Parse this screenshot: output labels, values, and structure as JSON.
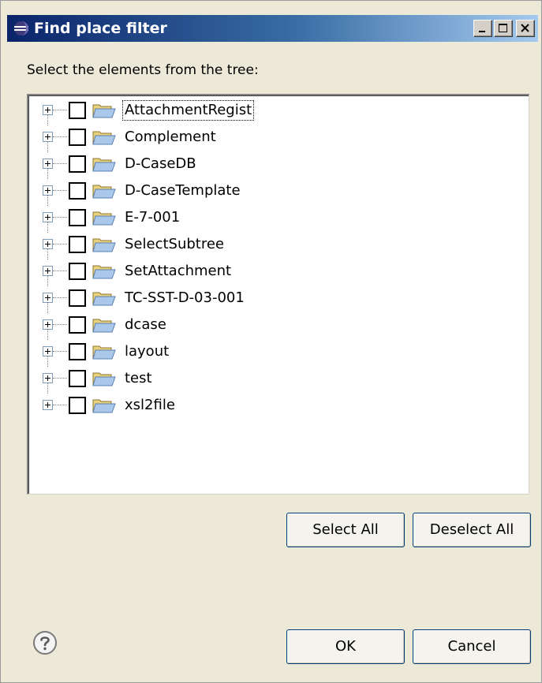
{
  "window": {
    "title": "Find place filter",
    "accent": "#0a246a"
  },
  "instruction": "Select the elements from the tree:",
  "tree": {
    "items": [
      {
        "label": "AttachmentRegist",
        "selected": true,
        "checked": false
      },
      {
        "label": "Complement",
        "checked": false
      },
      {
        "label": "D-CaseDB",
        "checked": false
      },
      {
        "label": "D-CaseTemplate",
        "checked": false
      },
      {
        "label": "E-7-001",
        "checked": false
      },
      {
        "label": "SelectSubtree",
        "checked": false
      },
      {
        "label": "SetAttachment",
        "checked": false
      },
      {
        "label": "TC-SST-D-03-001",
        "checked": false
      },
      {
        "label": "dcase",
        "checked": false
      },
      {
        "label": "layout",
        "checked": false
      },
      {
        "label": "test",
        "checked": false
      },
      {
        "label": "xsl2file",
        "checked": false
      }
    ]
  },
  "buttons": {
    "select_all": "Select All",
    "deselect_all": "Deselect All",
    "ok": "OK",
    "cancel": "Cancel"
  },
  "icons": {
    "title": "eclipse-icon",
    "item": "folder-icon",
    "expand": "plus-expander-icon",
    "help": "help-icon"
  }
}
